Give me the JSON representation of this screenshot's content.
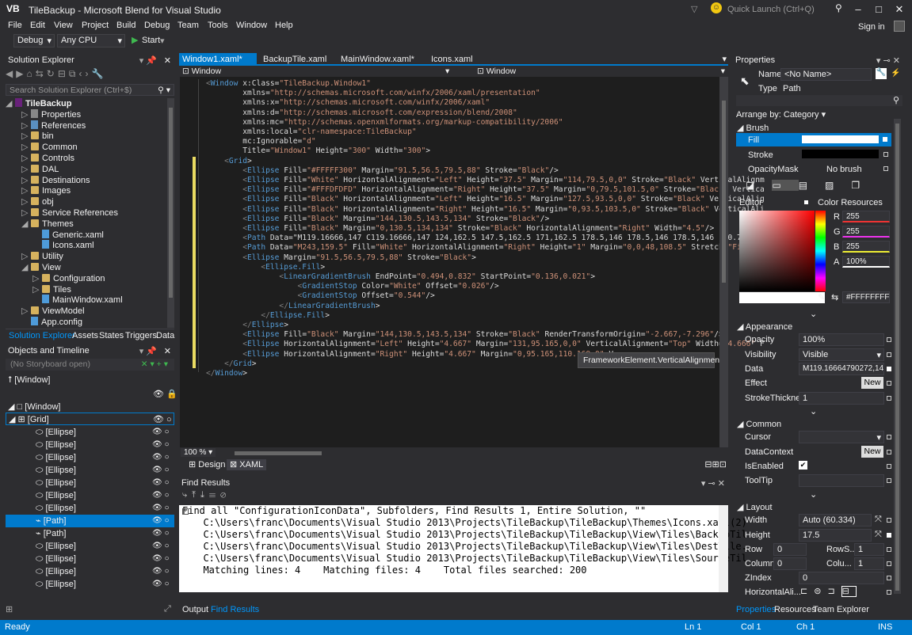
{
  "app": {
    "title": "TileBackup - Microsoft Blend for Visual Studio",
    "logo": "VB",
    "quick_launch_placeholder": "Quick Launch (Ctrl+Q)",
    "sign_in": "Sign in"
  },
  "menu": [
    "File",
    "Edit",
    "View",
    "Project",
    "Build",
    "Debug",
    "Team",
    "Tools",
    "Window",
    "Help"
  ],
  "toolbar": {
    "config": "Debug",
    "platform": "Any CPU",
    "start": "Start"
  },
  "solution_explorer": {
    "title": "Solution Explorer",
    "search_placeholder": "Search Solution Explorer (Ctrl+$)",
    "items": [
      {
        "label": "TileBackup",
        "indent": 0,
        "kind": "project"
      },
      {
        "label": "Properties",
        "indent": 1,
        "kind": "wrench"
      },
      {
        "label": "References",
        "indent": 1,
        "kind": "ref"
      },
      {
        "label": "bin",
        "indent": 1,
        "kind": "folder"
      },
      {
        "label": "Common",
        "indent": 1,
        "kind": "folder"
      },
      {
        "label": "Controls",
        "indent": 1,
        "kind": "folder"
      },
      {
        "label": "DAL",
        "indent": 1,
        "kind": "folder"
      },
      {
        "label": "Destinations",
        "indent": 1,
        "kind": "folder"
      },
      {
        "label": "Images",
        "indent": 1,
        "kind": "folder"
      },
      {
        "label": "obj",
        "indent": 1,
        "kind": "folder"
      },
      {
        "label": "Service References",
        "indent": 1,
        "kind": "folder"
      },
      {
        "label": "Themes",
        "indent": 1,
        "kind": "folder"
      },
      {
        "label": "Generic.xaml",
        "indent": 2,
        "kind": "file"
      },
      {
        "label": "Icons.xaml",
        "indent": 2,
        "kind": "file"
      },
      {
        "label": "Utility",
        "indent": 1,
        "kind": "folder"
      },
      {
        "label": "View",
        "indent": 1,
        "kind": "folder"
      },
      {
        "label": "Configuration",
        "indent": 2,
        "kind": "folder"
      },
      {
        "label": "Tiles",
        "indent": 2,
        "kind": "folder"
      },
      {
        "label": "MainWindow.xaml",
        "indent": 2,
        "kind": "file"
      },
      {
        "label": "ViewModel",
        "indent": 1,
        "kind": "folder"
      },
      {
        "label": "App.config",
        "indent": 1,
        "kind": "file"
      }
    ],
    "tabs": [
      "Solution Explorer",
      "Assets",
      "States",
      "Triggers",
      "Data"
    ]
  },
  "objects": {
    "title": "Objects and Timeline",
    "storyboard": "(No Storyboard open)",
    "root": "[Window]",
    "window_node": "[Window]",
    "grid_node": "[Grid]",
    "children": [
      "[Ellipse]",
      "[Ellipse]",
      "[Ellipse]",
      "[Ellipse]",
      "[Ellipse]",
      "[Ellipse]",
      "[Ellipse]",
      "[Path]",
      "[Path]",
      "[Ellipse]",
      "[Ellipse]",
      "[Ellipse]",
      "[Ellipse]"
    ],
    "selected_index": 7
  },
  "editor": {
    "tabs": [
      "Window1.xaml*",
      "BackupTile.xaml",
      "MainWindow.xaml*",
      "Icons.xaml"
    ],
    "nav_left": "Window",
    "nav_right": "Window",
    "zoom": "100 %",
    "view_tabs": [
      "Design",
      "XAML"
    ],
    "tooltip": "FrameworkElement.VerticalAlignment",
    "lines": [
      "<Window x:Class=\"TileBackup.Window1\"",
      "        xmlns=\"http://schemas.microsoft.com/winfx/2006/xaml/presentation\"",
      "        xmlns:x=\"http://schemas.microsoft.com/winfx/2006/xaml\"",
      "        xmlns:d=\"http://schemas.microsoft.com/expression/blend/2008\"",
      "        xmlns:mc=\"http://schemas.openxmlformats.org/markup-compatibility/2006\"",
      "        xmlns:local=\"clr-namespace:TileBackup\"",
      "        mc:Ignorable=\"d\"",
      "        Title=\"Window1\" Height=\"300\" Width=\"300\">",
      "    <Grid>",
      "        <Ellipse Fill=\"#FFFFF300\" Margin=\"91.5,56.5,79.5,88\" Stroke=\"Black\"/>",
      "        <Ellipse Fill=\"White\" HorizontalAlignment=\"Left\" Height=\"37.5\" Margin=\"114,79.5,0,0\" Stroke=\"Black\" VerticalAlignm",
      "        <Ellipse Fill=\"#FFFDFDFD\" HorizontalAlignment=\"Right\" Height=\"37.5\" Margin=\"0,79.5,101.5,0\" Stroke=\"Black\" Vertica",
      "        <Ellipse Fill=\"Black\" HorizontalAlignment=\"Left\" Height=\"16.5\" Margin=\"127.5,93.5,0,0\" Stroke=\"Black\" VerticalAlig",
      "        <Ellipse Fill=\"Black\" HorizontalAlignment=\"Right\" Height=\"16.5\" Margin=\"0,93.5,103.5,0\" Stroke=\"Black\" VerticalAli",
      "        <Ellipse Fill=\"Black\" Margin=\"144,130.5,143.5,134\" Stroke=\"Black\"/>",
      "        <Ellipse Fill=\"Black\" Margin=\"0,130.5,134,134\" Stroke=\"Black\" HorizontalAlignment=\"Right\" Width=\"4.5\"/>",
      "        <Path Data=\"M119.16666,147 C119.16666,147 124,162.5 147.5,162.5 171,162.5 178.5,146 178.5,146 178.5,146 160.75,154",
      "        <Path Data=\"M243,159.5\" Fill=\"White\" HorizontalAlignment=\"Right\" Height=\"1\" Margin=\"0,0,48,108.5\" Stretch=\"Fill\" S",
      "        <Ellipse Margin=\"91.5,56.5,79.5,88\" Stroke=\"Black\">",
      "            <Ellipse.Fill>",
      "                <LinearGradientBrush EndPoint=\"0.494,0.832\" StartPoint=\"0.136,0.021\">",
      "                    <GradientStop Color=\"White\" Offset=\"0.026\"/>",
      "                    <GradientStop Offset=\"0.544\"/>",
      "                </LinearGradientBrush>",
      "            </Ellipse.Fill>",
      "        </Ellipse>",
      "        <Ellipse Fill=\"Black\" Margin=\"144,130.5,143.5,134\" Stroke=\"Black\" RenderTransformOrigin=\"-2.667,-7.296\"/>",
      "        <Ellipse HorizontalAlignment=\"Left\" Height=\"4.667\" Margin=\"131,95.165,0,0\" VerticalAlignment=\"Top\" Width=\"4.666\" F",
      "        <Ellipse HorizontalAlignment=\"Right\" Height=\"4.667\" Margin=\"0,95.165,110.169,0\" V",
      "    </Grid>",
      "</Window>"
    ]
  },
  "find_results": {
    "title": "Find Results",
    "lines": [
      "Find all \"ConfigurationIconData\", Subfolders, Find Results 1, Entire Solution, \"\"",
      "  C:\\Users\\franc\\Documents\\Visual Studio 2013\\Projects\\TileBackup\\TileBackup\\Themes\\Icons.xaml(2)",
      "  C:\\Users\\franc\\Documents\\Visual Studio 2013\\Projects\\TileBackup\\TileBackup\\View\\Tiles\\BackupTil",
      "  C:\\Users\\franc\\Documents\\Visual Studio 2013\\Projects\\TileBackup\\TileBackup\\View\\Tiles\\DestTile.",
      "  C:\\Users\\franc\\Documents\\Visual Studio 2013\\Projects\\TileBackup\\TileBackup\\View\\Tiles\\SourceTil",
      "  Matching lines: 4    Matching files: 4    Total files searched: 200"
    ],
    "tabs": [
      "Output",
      "Find Results"
    ]
  },
  "properties": {
    "title": "Properties",
    "name_label": "Name",
    "name_value": "<No Name>",
    "type_label": "Type",
    "type_value": "Path",
    "arrange": "Arrange by: Category",
    "brush_section": "Brush",
    "fill": "Fill",
    "stroke": "Stroke",
    "opacity_mask": "OpacityMask",
    "no_brush": "No brush",
    "editor_label": "Editor",
    "color_resources": "Color Resources",
    "r": "255",
    "g": "255",
    "b": "255",
    "a": "100%",
    "r_label": "R",
    "g_label": "G",
    "b_label": "B",
    "a_label": "A",
    "hex": "#FFFFFFFF",
    "appearance": "Appearance",
    "opacity_label": "Opacity",
    "opacity": "100%",
    "visibility_label": "Visibility",
    "visibility": "Visible",
    "data_label": "Data",
    "data": "M119.16664790272,147...",
    "effect_label": "Effect",
    "new": "New",
    "strokethickness_label": "StrokeThickne...",
    "strokethickness": "1",
    "common": "Common",
    "cursor_label": "Cursor",
    "datacontext_label": "DataContext",
    "isenabled_label": "IsEnabled",
    "tooltip_label": "ToolTip",
    "layout": "Layout",
    "width_label": "Width",
    "width": "Auto (60.334)",
    "height_label": "Height",
    "height": "17.5",
    "row_label": "Row",
    "row": "0",
    "rowspan_label": "RowS...",
    "rowspan": "1",
    "column_label": "Column",
    "column": "0",
    "colspan_label": "Colu...",
    "colspan": "1",
    "zindex_label": "ZIndex",
    "zindex": "0",
    "halign_label": "HorizontalAli...",
    "tabs": [
      "Properties",
      "Resources",
      "Team Explorer"
    ]
  },
  "status": {
    "ready": "Ready",
    "ln": "Ln 1",
    "col": "Col 1",
    "ch": "Ch 1",
    "ins": "INS"
  },
  "colors": {
    "accent": "#007acc",
    "bg": "#2d2d30",
    "editor_bg": "#1e1e1e"
  }
}
